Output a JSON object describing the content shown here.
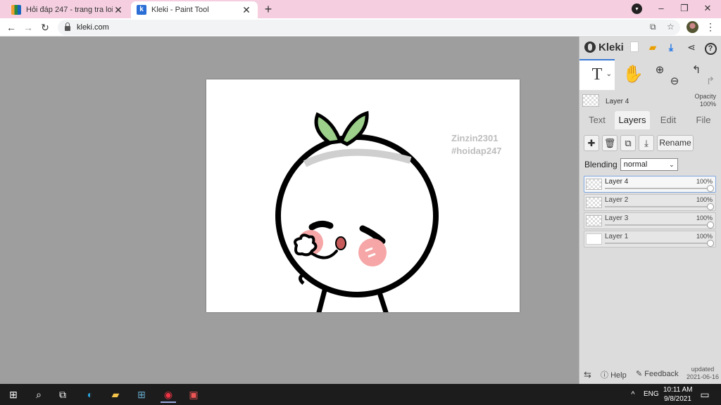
{
  "browser": {
    "tabs": [
      {
        "title": "Hỏi đáp 247 - trang tra loi",
        "close": "✕"
      },
      {
        "title": "Kleki - Paint Tool",
        "close": "✕"
      }
    ],
    "new_tab": "+",
    "url": "kleki.com",
    "window_controls": {
      "minimize": "–",
      "restore": "❐",
      "close": "✕"
    }
  },
  "canvas": {
    "watermark_line1": "Zinzin2301",
    "watermark_line2": "#hoidap247"
  },
  "kleki": {
    "logo": "Kleki",
    "tool_text_symbol": "T",
    "active_layer": {
      "name": "Layer 4",
      "opacity_label": "Opacity",
      "opacity_value": "100%"
    },
    "tabs": [
      "Text",
      "Layers",
      "Edit",
      "File"
    ],
    "active_tab": "Layers",
    "rename_label": "Rename",
    "blending_label": "Blending",
    "blending_value": "normal",
    "layers": [
      {
        "name": "Layer 4",
        "opacity": "100%",
        "selected": true,
        "thumb": "transparent"
      },
      {
        "name": "Layer 2",
        "opacity": "100%",
        "selected": false,
        "thumb": "transparent"
      },
      {
        "name": "Layer 3",
        "opacity": "100%",
        "selected": false,
        "thumb": "transparent"
      },
      {
        "name": "Layer 1",
        "opacity": "100%",
        "selected": false,
        "thumb": "white"
      }
    ],
    "footer": {
      "help": "Help",
      "feedback": "Feedback",
      "updated_label": "updated",
      "updated_date": "2021-06-16"
    }
  },
  "taskbar": {
    "language": "ENG",
    "time": "10:11 AM",
    "date": "9/8/2021"
  },
  "colors": {
    "tabstrip": "#f5cfe0",
    "accent": "#3a7bd5",
    "panel": "#dcdcdc",
    "workspace": "#9e9e9e"
  }
}
